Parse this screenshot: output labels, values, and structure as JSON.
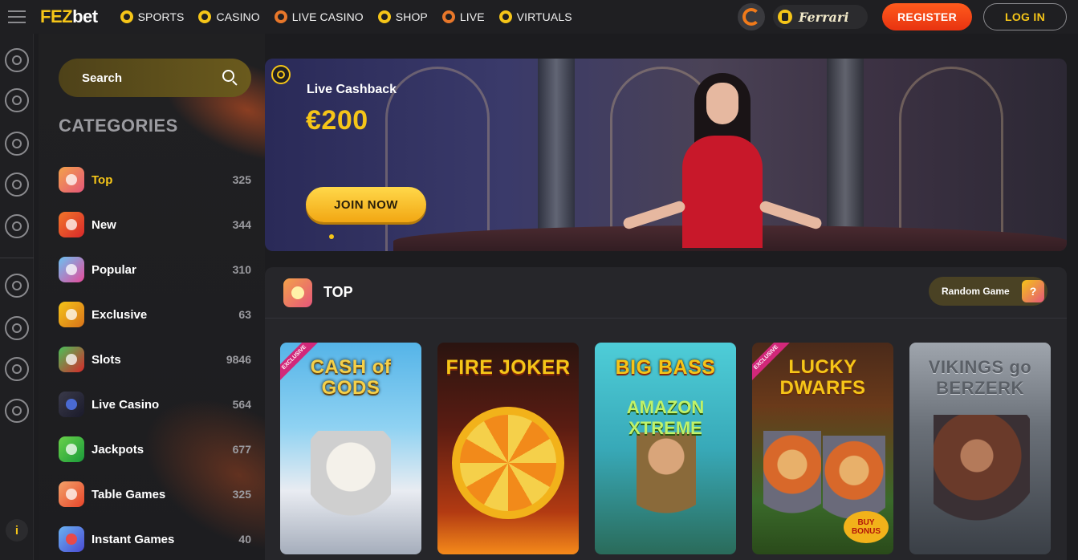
{
  "header": {
    "logo_fez": "FEZ",
    "logo_bet": "bet",
    "nav": [
      {
        "label": "SPORTS",
        "icon": "soccer-ball-icon"
      },
      {
        "label": "CASINO",
        "icon": "spade-icon"
      },
      {
        "label": "LIVE CASINO",
        "icon": "roulette-icon"
      },
      {
        "label": "SHOP",
        "icon": "shopping-bag-icon"
      },
      {
        "label": "LIVE",
        "icon": "live-signal-icon"
      },
      {
        "label": "VIRTUALS",
        "icon": "virtuals-icon"
      }
    ],
    "ferrari_label": "Ferrari",
    "register_label": "REGISTER",
    "login_label": "LOG IN"
  },
  "rail": {
    "icons": [
      "soccer-ball-icon",
      "spade-icon",
      "roulette-icon",
      "live-signal-icon",
      "virtuals-icon",
      "wheel-icon",
      "star-icon",
      "trophy-icon",
      "shopping-bag-icon"
    ],
    "info_label": "i"
  },
  "sidebar": {
    "search_placeholder": "Search",
    "categories_title": "CATEGORIES",
    "categories": [
      {
        "label": "Top",
        "count": "325",
        "active": true,
        "color": "#e86aa0"
      },
      {
        "label": "New",
        "count": "344",
        "color": "#e8452a"
      },
      {
        "label": "Popular",
        "count": "310",
        "color": "#6ac2f2"
      },
      {
        "label": "Exclusive",
        "count": "63",
        "color": "#f2a21a"
      },
      {
        "label": "Slots",
        "count": "9846",
        "color": "#3ab24a"
      },
      {
        "label": "Live Casino",
        "count": "564",
        "color": "#2a2a3a"
      },
      {
        "label": "Jackpots",
        "count": "677",
        "color": "#2ab24a"
      },
      {
        "label": "Table Games",
        "count": "325",
        "color": "#f26a4a"
      },
      {
        "label": "Instant Games",
        "count": "40",
        "color": "#4a8af2"
      }
    ]
  },
  "banner": {
    "subtitle": "Live Cashback",
    "amount": "€200",
    "cta": "JOIN NOW"
  },
  "top_section": {
    "title": "TOP",
    "random_label": "Random Game",
    "random_icon_text": "?",
    "games": [
      {
        "title": "CASH of GODS",
        "ribbon": "EXCLUSIVE"
      },
      {
        "title": "FIRE JOKER"
      },
      {
        "title": "BIG BASS",
        "subtitle": "AMAZON XTREME"
      },
      {
        "title": "LUCKY DWARFS",
        "ribbon": "EXCLUSIVE",
        "badge": "BUY BONUS"
      },
      {
        "title": "VIKINGS go BERZERK"
      }
    ]
  },
  "colors": {
    "accent": "#f5c518",
    "register": "#f04a18",
    "background": "#1c1c1f"
  }
}
